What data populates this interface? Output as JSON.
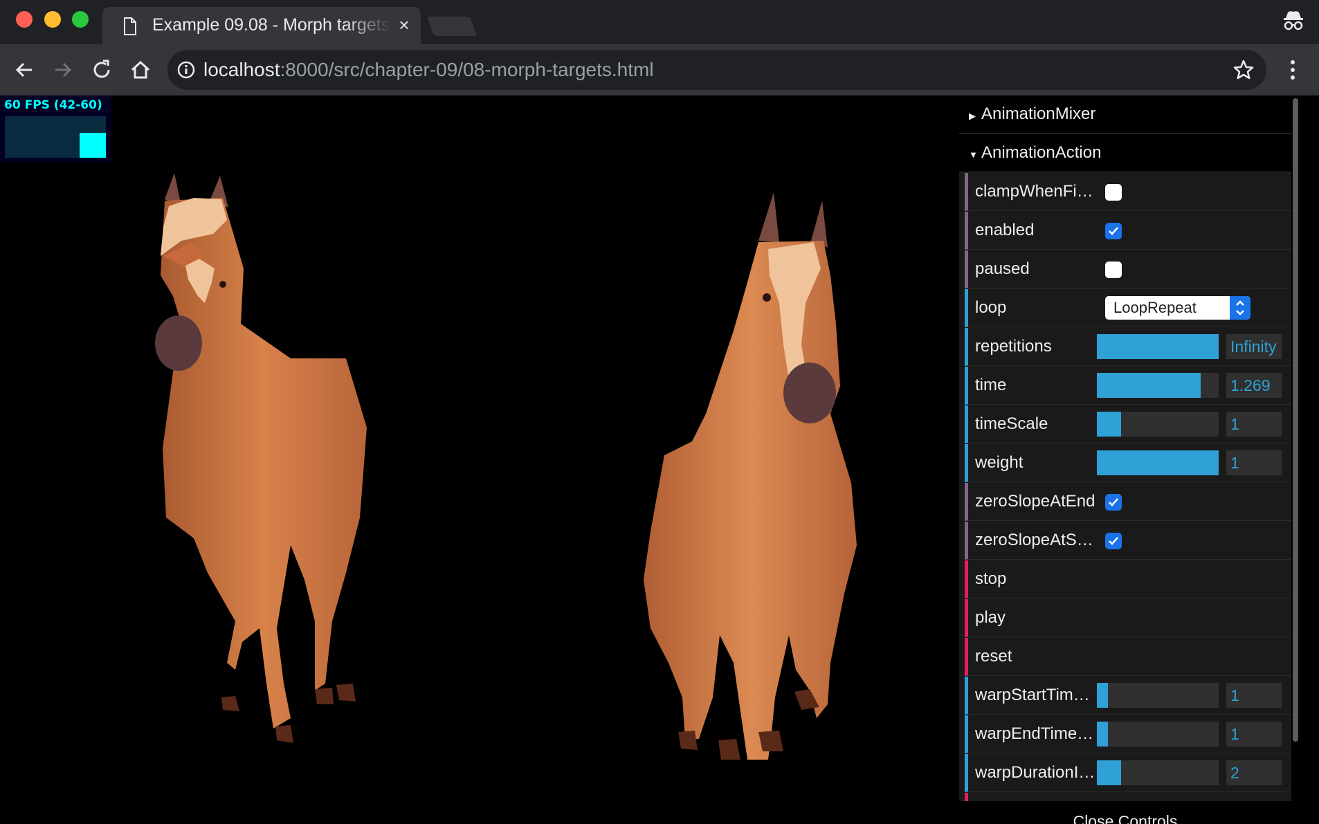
{
  "browser": {
    "tab_title": "Example 09.08 - Morph targets",
    "url_host": "localhost",
    "url_path": ":8000/src/chapter-09/08-morph-targets.html"
  },
  "stats": {
    "fps_text": "60 FPS (42-60)"
  },
  "gui": {
    "folders": [
      {
        "label": "AnimationMixer",
        "open": false
      },
      {
        "label": "AnimationAction",
        "open": true
      }
    ],
    "props": {
      "clampWhenFinished": {
        "label": "clampWhenFin…",
        "checked": false
      },
      "enabled": {
        "label": "enabled",
        "checked": true
      },
      "paused": {
        "label": "paused",
        "checked": false
      },
      "loop": {
        "label": "loop",
        "value": "LoopRepeat"
      },
      "repetitions": {
        "label": "repetitions",
        "value": "Infinity",
        "fill": 1.0
      },
      "time": {
        "label": "time",
        "value": "1.269",
        "fill": 0.85
      },
      "timeScale": {
        "label": "timeScale",
        "value": "1",
        "fill": 0.2
      },
      "weight": {
        "label": "weight",
        "value": "1",
        "fill": 1.0
      },
      "zeroSlopeAtEnd": {
        "label": "zeroSlopeAtEnd",
        "checked": true
      },
      "zeroSlopeAtStart": {
        "label": "zeroSlopeAtStart",
        "checked": true
      },
      "stop": {
        "label": "stop"
      },
      "play": {
        "label": "play"
      },
      "reset": {
        "label": "reset"
      },
      "warpStartTimeScale": {
        "label": "warpStartTime…",
        "value": "1",
        "fill": 0.09
      },
      "warpEndTimeScale": {
        "label": "warpEndTimeS…",
        "value": "1",
        "fill": 0.09
      },
      "warpDurationInSeconds": {
        "label": "warpDurationI…",
        "value": "2",
        "fill": 0.2
      }
    },
    "close_label": "Close Controls"
  },
  "colors": {
    "number_accent": "#2fa1d6",
    "boolean_accent": "#806787",
    "function_accent": "#e61d5f",
    "horse_body": "#c8703e",
    "horse_blaze": "#f0c49a",
    "horse_muzzle": "#5a3a3c"
  },
  "icons": [
    "document-icon",
    "close-icon",
    "incognito-icon",
    "back-icon",
    "forward-icon",
    "reload-icon",
    "home-icon",
    "info-icon",
    "star-icon",
    "menu-icon",
    "checkmark-icon",
    "select-arrows-icon",
    "caret-icon"
  ]
}
